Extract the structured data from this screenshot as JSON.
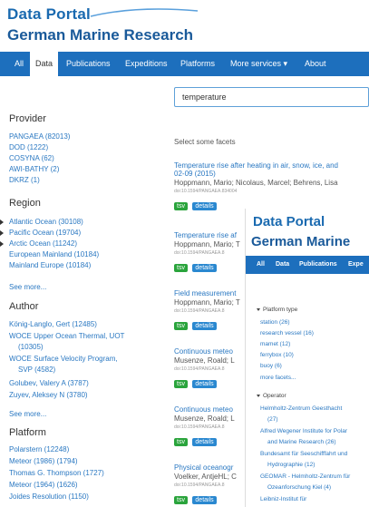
{
  "brand": {
    "line1": "Data Portal",
    "line2": "German Marine Research",
    "accent": "#1d6fbd"
  },
  "nav": {
    "items": [
      "All",
      "Data",
      "Publications",
      "Expeditions",
      "Platforms",
      "More services ▾",
      "About"
    ],
    "active": "Data"
  },
  "search": {
    "value": "temperature"
  },
  "sidebar": {
    "provider": {
      "title": "Provider",
      "items": [
        "PANGAEA (82013)",
        "DOD (1222)",
        "COSYNA (62)",
        "AWI-BATHY (2)",
        "DKRZ (1)"
      ]
    },
    "region": {
      "title": "Region",
      "items": [
        "Atlantic Ocean (30108)",
        "Pacific Ocean (19704)",
        "Arctic Ocean (11242)",
        "European Mainland (10184)",
        "Mainland Europe (10184)"
      ],
      "see_more": "See more..."
    },
    "author": {
      "title": "Author",
      "items": [
        "König-Langlo, Gert (12485)",
        "WOCE Upper Ocean Thermal, UOT",
        "(10305)",
        "WOCE Surface Velocity Program,",
        "SVP (4582)",
        "Golubev, Valery A (3787)",
        "Zuyev, Aleksey N (3780)"
      ],
      "see_more": "See more..."
    },
    "platform": {
      "title": "Platform",
      "items": [
        "Polarstern (12248)",
        "Meteor (1986) (1794)",
        "Thomas G. Thompson (1727)",
        "Meteor (1964) (1626)",
        "Joides Resolution (1150)"
      ]
    }
  },
  "results": {
    "select_facets": "Select some facets",
    "items": [
      {
        "title": "Temperature rise after heating in air, snow, ice, and",
        "title2": "02-09 (2015)",
        "authors": "Hoppmann, Mario; Nicolaus, Marcel; Behrens, Lisa",
        "doi": "doi:10.1594/PANGAEA.834004"
      },
      {
        "title": "Temperature rise af",
        "authors": "Hoppmann, Mario; T",
        "doi": "doi:10.1594/PANGAEA.8"
      },
      {
        "title": "Field measurement",
        "authors": "Hoppmann, Mario; T",
        "doi": "doi:10.1594/PANGAEA.8"
      },
      {
        "title": "Continuous meteo",
        "authors": "Musenze, Roald; L",
        "doi": "doi:10.1594/PANGAEA.8"
      },
      {
        "title": "Continuous meteo",
        "authors": "Musenze, Roald; L",
        "doi": "doi:10.1594/PANGAEA.8"
      },
      {
        "title": "Physical oceanogr",
        "authors": "Voelker, AntjeHL; C",
        "doi": "doi:10.1594/PANGAEA.8"
      }
    ],
    "tsv_label": "tsv",
    "details_label": "details"
  },
  "inset": {
    "logo1": "Data Portal",
    "logo2": "German Marine",
    "nav": [
      "All",
      "Data",
      "Publications",
      "Expe"
    ],
    "platform_type_label": "Platform type",
    "platform_types": [
      "station (26)",
      "research vessel (16)",
      "mamet (12)",
      "ferrybox (10)",
      "buoy (6)",
      "more facets..."
    ],
    "operator_label": "Operator",
    "operators": [
      "Helmholtz-Zentrum Geesthacht",
      "(27)",
      "Alfred Wegener Institute for Polar",
      "and Marine Research (26)",
      "Bundesamt für Seeschifffahrt und",
      "Hydrographie (12)",
      "GEOMAR - Helmholtz-Zentrum für",
      "Ozeanforschung Kiel (4)",
      "Leibniz-Institut für"
    ]
  }
}
